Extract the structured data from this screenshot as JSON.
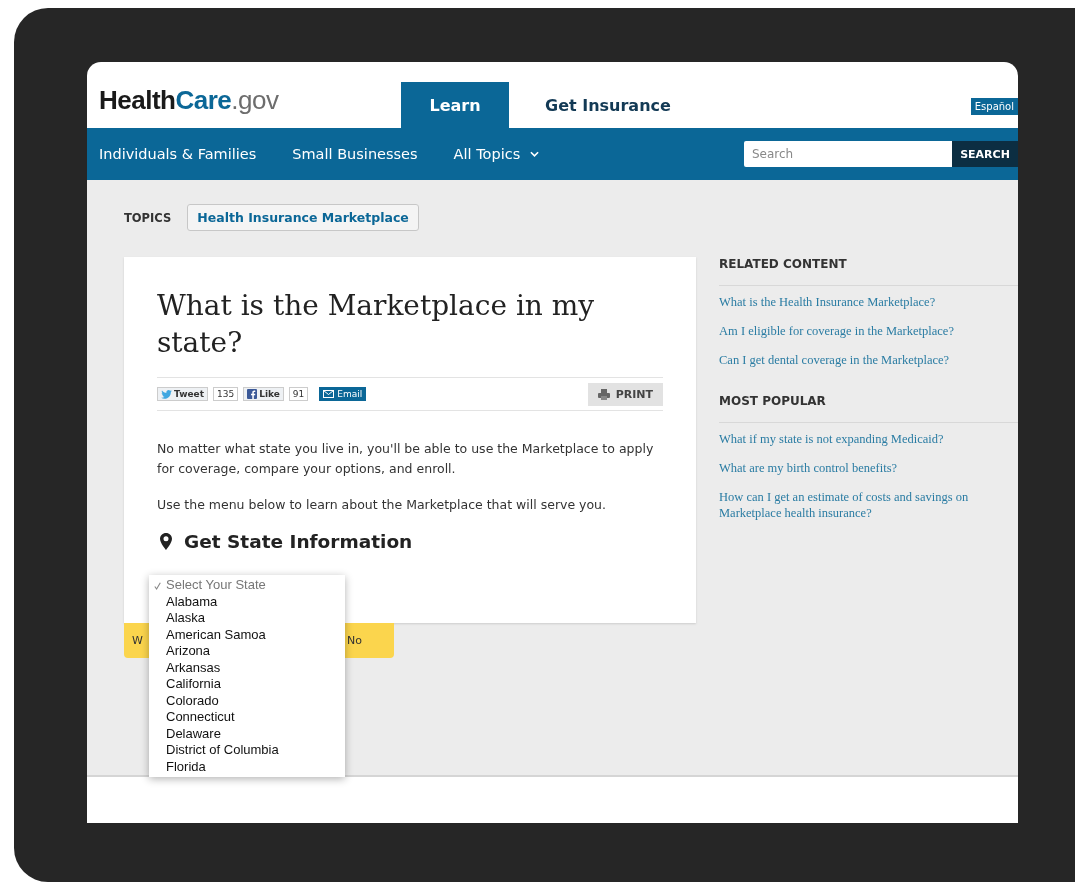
{
  "header": {
    "logo": [
      "Health",
      "Care",
      ".gov"
    ],
    "tabs": [
      {
        "label": "Learn",
        "selected": true
      },
      {
        "label": "Get Insurance",
        "selected": false
      }
    ],
    "language_button": "Español"
  },
  "nav": {
    "items": [
      {
        "label": "Individuals & Families",
        "dropdown": false
      },
      {
        "label": "Small Businesses",
        "dropdown": false
      },
      {
        "label": "All Topics",
        "dropdown": true
      }
    ],
    "search": {
      "placeholder": "Search",
      "button": "SEARCH"
    }
  },
  "topics": {
    "label": "TOPICS",
    "tag": "Health Insurance Marketplace"
  },
  "article": {
    "title": "What is the Marketplace in my state?",
    "share": {
      "tweet": "Tweet",
      "tweet_count": "135",
      "like": "Like",
      "like_count": "91",
      "email": "Email",
      "print": "PRINT"
    },
    "paragraphs": [
      "No matter what state you live in, you'll be able to use the Marketplace to apply for coverage, compare your options, and enroll.",
      "Use the menu below to learn about the Marketplace that will serve you."
    ],
    "state_heading": "Get State Information",
    "state_dropdown": {
      "options": [
        {
          "label": "Select Your State",
          "selected": true
        },
        {
          "label": "Alabama",
          "selected": false
        },
        {
          "label": "Alaska",
          "selected": false
        },
        {
          "label": "American Samoa",
          "selected": false
        },
        {
          "label": "Arizona",
          "selected": false
        },
        {
          "label": "Arkansas",
          "selected": false
        },
        {
          "label": "California",
          "selected": false
        },
        {
          "label": "Colorado",
          "selected": false
        },
        {
          "label": "Connecticut",
          "selected": false
        },
        {
          "label": "Delaware",
          "selected": false
        },
        {
          "label": "District of Columbia",
          "selected": false
        },
        {
          "label": "Florida",
          "selected": false
        }
      ]
    }
  },
  "feedback": {
    "texts": [
      "W",
      "No"
    ]
  },
  "sidebar": {
    "sections": [
      {
        "heading": "RELATED CONTENT",
        "links": [
          "What is the Health Insurance Marketplace?",
          "Am I eligible for coverage in the Marketplace?",
          "Can I get dental coverage in the Marketplace?"
        ]
      },
      {
        "heading": "MOST POPULAR",
        "links": [
          "What if my state is not expanding Medicaid?",
          "What are my birth control benefits?",
          "How can I get an estimate of costs and savings on Marketplace health insurance?"
        ]
      }
    ]
  }
}
